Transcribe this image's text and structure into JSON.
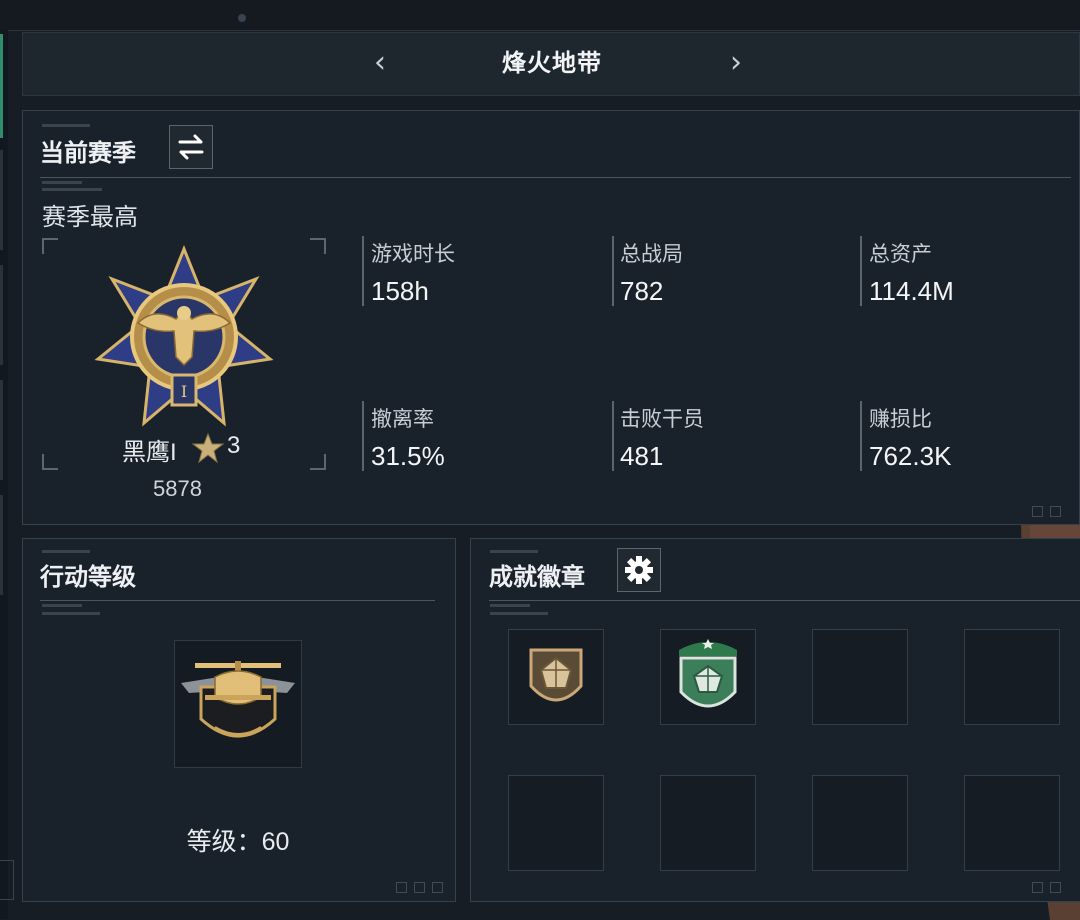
{
  "top": {
    "title_fragment": ""
  },
  "map": {
    "name": "烽火地带",
    "prev_icon": "chevron-left-icon",
    "next_icon": "chevron-right-icon"
  },
  "season": {
    "title": "当前赛季",
    "switch_icon": "swap-arrows-icon",
    "subtitle": "赛季最高",
    "rank_name": "黑鹰I",
    "rank_stars": "3",
    "rank_points": "5878",
    "stats": [
      {
        "label": "游戏时长",
        "value": "158h"
      },
      {
        "label": "总战局",
        "value": "782"
      },
      {
        "label": "总资产",
        "value": "114.4M"
      },
      {
        "label": "撤离率",
        "value": "31.5%"
      },
      {
        "label": "击败干员",
        "value": "481"
      },
      {
        "label": "赚损比",
        "value": "762.3K"
      }
    ]
  },
  "action_level": {
    "title": "行动等级",
    "level_text": "等级：60",
    "badge_icon": "helicopter-badge-icon"
  },
  "achievements": {
    "title": "成就徽章",
    "settings_icon": "gear-icon",
    "slots": [
      {
        "badge": "bronze-shield-badge"
      },
      {
        "badge": "green-shield-badge"
      },
      {
        "badge": ""
      },
      {
        "badge": ""
      },
      {
        "badge": ""
      },
      {
        "badge": ""
      },
      {
        "badge": ""
      },
      {
        "badge": ""
      }
    ]
  },
  "colors": {
    "background": "#161d24",
    "panel": "#19212a",
    "gold": "#c9a45a",
    "navy": "#2c3a7a",
    "green": "#2f6b4a"
  }
}
